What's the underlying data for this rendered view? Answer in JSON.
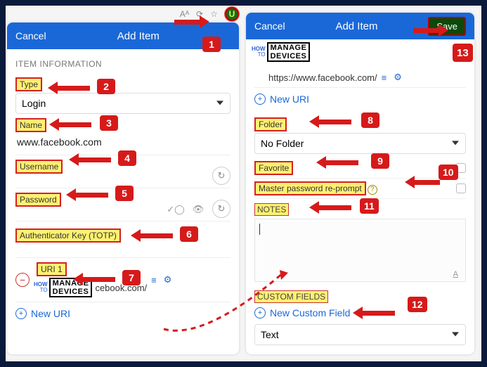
{
  "topicons": {
    "shield_letter": "U",
    "a_icon": "Aᴬ",
    "sync": "⟳",
    "star": "☆"
  },
  "left": {
    "header": {
      "cancel": "Cancel",
      "title": "Add Item"
    },
    "section": "ITEM INFORMATION",
    "type_label": "Type",
    "type_value": "Login",
    "name_label": "Name",
    "name_value": "www.facebook.com",
    "username_label": "Username",
    "password_label": "Password",
    "totp_label": "Authenticator Key (TOTP)",
    "uri1_label": "URI 1",
    "uri1_value": "cebook.com/",
    "newuri": "New URI"
  },
  "right": {
    "header": {
      "cancel": "Cancel",
      "title": "Add Item",
      "save": "Save"
    },
    "uri_value": "https://www.facebook.com/",
    "newuri": "New URI",
    "folder_label": "Folder",
    "folder_value": "No Folder",
    "favorite_label": "Favorite",
    "reprompt_label": "Master password re-prompt",
    "notes_label": "NOTES",
    "custom_label": "CUSTOM FIELDS",
    "newcustom": "New Custom Field",
    "custom_type": "Text"
  },
  "badges": {
    "b1": "1",
    "b2": "2",
    "b3": "3",
    "b4": "4",
    "b5": "5",
    "b6": "6",
    "b7": "7",
    "b8": "8",
    "b9": "9",
    "b10": "10",
    "b11": "11",
    "b12": "12",
    "b13": "13"
  },
  "watermark": {
    "how": "HOW",
    "to": "TO",
    "md1": "MANAGE",
    "md2": "DEVICES"
  }
}
